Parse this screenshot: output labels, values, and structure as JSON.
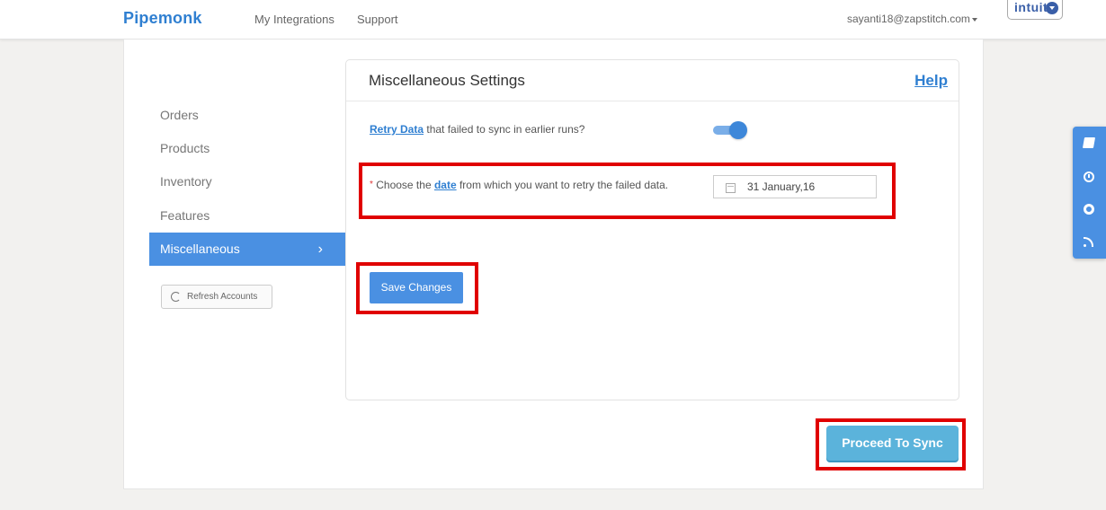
{
  "navbar": {
    "brand": "Pipemonk",
    "links": [
      "My Integrations",
      "Support"
    ],
    "user_email": "sayanti18@zapstitch.com",
    "intuit_logo": "intuit."
  },
  "sidebar": {
    "items": [
      {
        "label": "Orders",
        "active": false
      },
      {
        "label": "Products",
        "active": false
      },
      {
        "label": "Inventory",
        "active": false
      },
      {
        "label": "Features",
        "active": false
      },
      {
        "label": "Miscellaneous",
        "active": true
      }
    ],
    "refresh_label": "Refresh Accounts"
  },
  "panel": {
    "title": "Miscellaneous Settings",
    "help": "Help",
    "retry": {
      "link": "Retry Data",
      "text": " that failed to sync in earlier runs?",
      "toggle_on": true
    },
    "date": {
      "asterisk": "*",
      "prefix": " Choose the ",
      "link": "date",
      "suffix": " from which you want to retry the failed data.",
      "value": "31 January,16"
    },
    "save_label": "Save Changes"
  },
  "proceed_label": "Proceed To Sync",
  "colors": {
    "accent": "#4a90e2",
    "brand": "#2f7fd1",
    "proceed": "#5bb3db",
    "annotation": "#e00000"
  },
  "float_toolbar": [
    "book-icon",
    "clock-icon",
    "lifebuoy-icon",
    "rss-icon"
  ]
}
